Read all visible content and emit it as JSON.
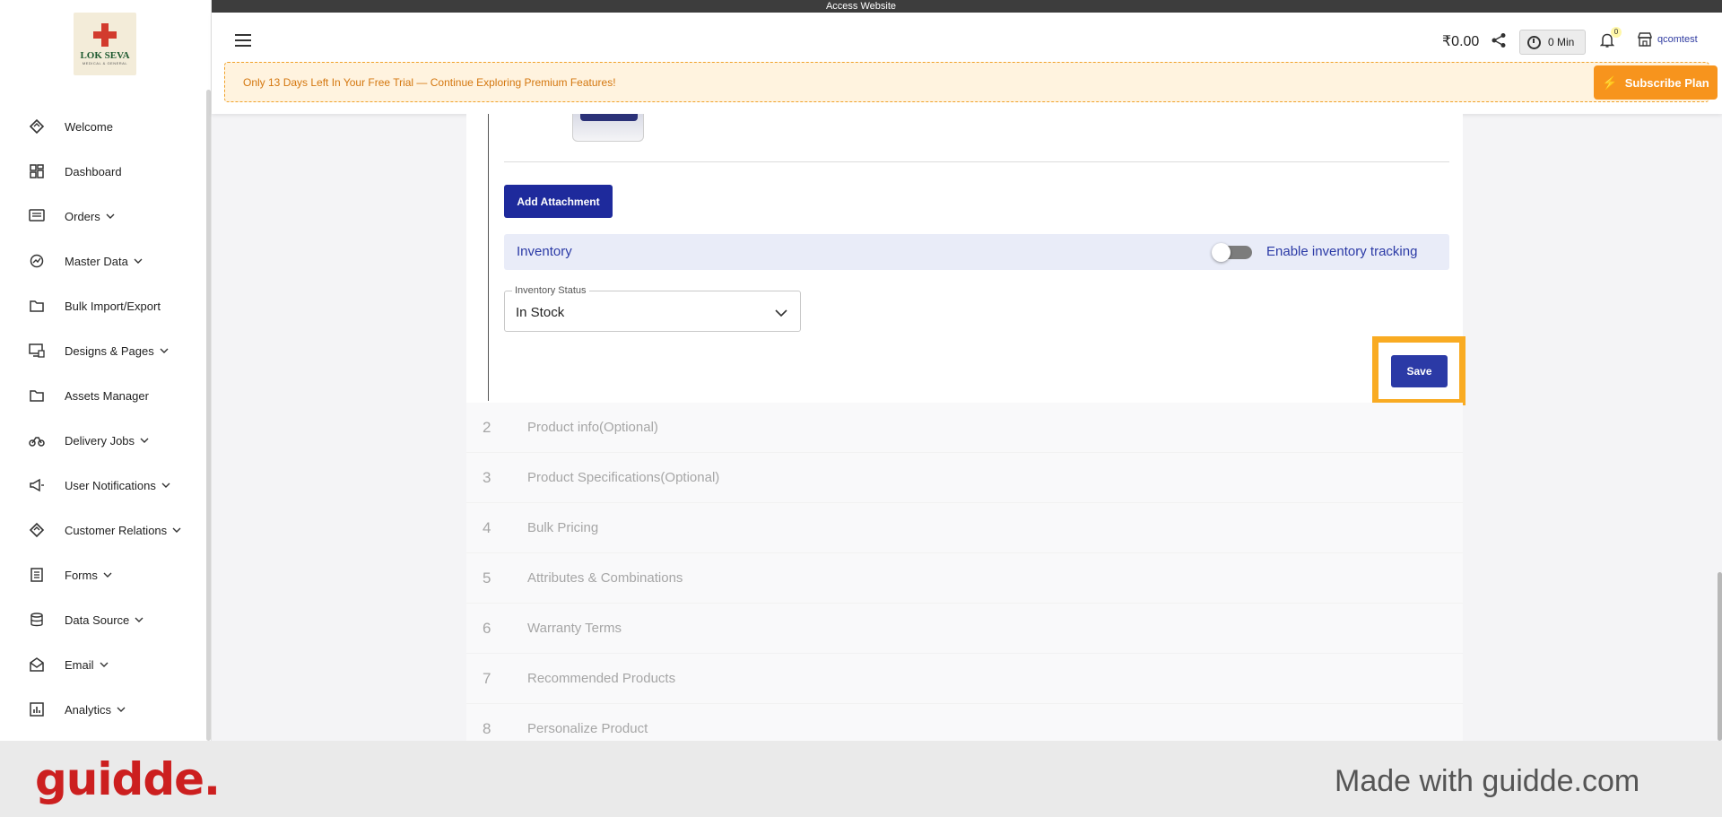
{
  "access_bar": {
    "label": "Access Website"
  },
  "logo": {
    "name": "LOK SEVA",
    "tagline": "MEDICAL & GENERAL"
  },
  "sidebar": {
    "items": [
      {
        "label": "Welcome",
        "icon": "welcome-icon",
        "has_chevron": false
      },
      {
        "label": "Dashboard",
        "icon": "dashboard-icon",
        "has_chevron": false
      },
      {
        "label": "Orders",
        "icon": "orders-icon",
        "has_chevron": true
      },
      {
        "label": "Master Data",
        "icon": "master-data-icon",
        "has_chevron": true
      },
      {
        "label": "Bulk Import/Export",
        "icon": "folder-icon",
        "has_chevron": false
      },
      {
        "label": "Designs & Pages",
        "icon": "designs-icon",
        "has_chevron": true
      },
      {
        "label": "Assets Manager",
        "icon": "folder-icon",
        "has_chevron": false
      },
      {
        "label": "Delivery Jobs",
        "icon": "scooter-icon",
        "has_chevron": true
      },
      {
        "label": "User Notifications",
        "icon": "megaphone-icon",
        "has_chevron": true
      },
      {
        "label": "Customer Relations",
        "icon": "handshake-icon",
        "has_chevron": true
      },
      {
        "label": "Forms",
        "icon": "forms-icon",
        "has_chevron": true
      },
      {
        "label": "Data Source",
        "icon": "database-icon",
        "has_chevron": true
      },
      {
        "label": "Email",
        "icon": "email-icon",
        "has_chevron": true
      },
      {
        "label": "Analytics",
        "icon": "analytics-icon",
        "has_chevron": true
      }
    ]
  },
  "header": {
    "balance": "₹0.00",
    "timer": "0 Min",
    "notification_count": "0",
    "store_name": "qcomtest",
    "trial_message": "Only 13 Days Left In Your Free Trial — Continue Exploring Premium Features!",
    "subscribe_label": "Subscribe Plan"
  },
  "form": {
    "add_attachment_label": "Add Attachment",
    "inventory_title": "Inventory",
    "tracking_label": "Enable inventory tracking",
    "tracking_enabled": false,
    "inventory_status_label": "Inventory Status",
    "inventory_status_value": "In Stock",
    "save_label": "Save"
  },
  "steps": [
    {
      "num": "2",
      "label": "Product info(Optional)"
    },
    {
      "num": "3",
      "label": "Product Specifications(Optional)"
    },
    {
      "num": "4",
      "label": "Bulk Pricing"
    },
    {
      "num": "5",
      "label": "Attributes & Combinations"
    },
    {
      "num": "6",
      "label": "Warranty Terms"
    },
    {
      "num": "7",
      "label": "Recommended Products"
    },
    {
      "num": "8",
      "label": "Personalize Product"
    }
  ],
  "footer": {
    "brand": "guidde.",
    "made_with": "Made with guidde.com"
  },
  "colors": {
    "primary": "#2b3aa6",
    "accent": "#f7941d",
    "highlight": "#f9ab22",
    "brand_red": "#cc1f1f"
  }
}
